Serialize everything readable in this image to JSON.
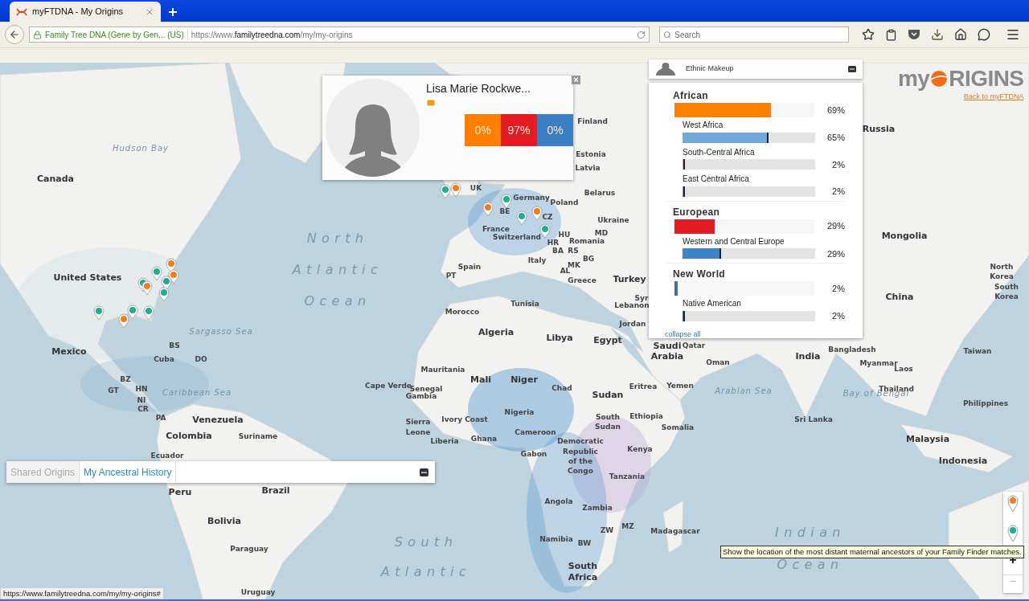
{
  "browser": {
    "tab_title": "myFTDNA - My Origins",
    "site_identity": "Family Tree DNA (Gene by Gen... (US)",
    "url_prefix": "https://www.",
    "url_domain": "familytreedna.com",
    "url_path": "/my/my-origins",
    "search": {
      "placeholder": "Search"
    },
    "status_url": "https://www.familytreedna.com/my/my-origins#"
  },
  "logo": {
    "left": "my",
    "right": "RIGINS",
    "link": "Back to myFTDNA"
  },
  "profile": {
    "name": "Lisa Marie Rockwe...",
    "close": "×",
    "percentages": [
      {
        "value": "0%",
        "color": "#ff8000"
      },
      {
        "value": "97%",
        "color": "#e31b23"
      },
      {
        "value": "0%",
        "color": "#3a7fc1"
      }
    ]
  },
  "ethnic_makeup": {
    "title": "Ethnic Makeup",
    "collapse": "collapse all",
    "groups": [
      {
        "name": "African",
        "percent": "69%",
        "level": 0.69,
        "color": "#ff8000",
        "children": [
          {
            "name": "West Africa",
            "percent": "65%",
            "level": 0.65,
            "color": "#6fa8dc"
          },
          {
            "name": "South-Central Africa",
            "percent": "2%",
            "level": 0.02,
            "color": "#e6a0a8"
          },
          {
            "name": "East Central Africa",
            "percent": "2%",
            "level": 0.02,
            "color": "#8a8ac8"
          }
        ]
      },
      {
        "name": "European",
        "percent": "29%",
        "level": 0.29,
        "color": "#e31b23",
        "children": [
          {
            "name": "Western and Central Europe",
            "percent": "29%",
            "level": 0.29,
            "color": "#3d85c6"
          }
        ]
      },
      {
        "name": "New World",
        "percent": "2%",
        "level": 0.02,
        "color": "#3d6fa8",
        "children": [
          {
            "name": "Native American",
            "percent": "2%",
            "level": 0.02,
            "color": "#3d6fa8"
          }
        ]
      }
    ]
  },
  "tabs": [
    {
      "label": "Shared Origins",
      "selected": false
    },
    {
      "label": "My Ancestral History",
      "selected": true
    }
  ],
  "map_controls": {
    "zoom_in": "+",
    "zoom_out": "−",
    "tooltip": "Show the location of the most distant maternal ancestors of your Family Finder matches."
  },
  "markers": [
    {
      "color": "#f07e1e"
    },
    {
      "color": "#1fae8f"
    },
    {
      "color": "#f07e1e"
    },
    {
      "color": "#1fae8f"
    },
    {
      "color": "#1fae8f"
    },
    {
      "color": "#f07e1e"
    },
    {
      "color": "#1fae8f"
    },
    {
      "color": "#1fae8f"
    },
    {
      "color": "#1fae8f"
    },
    {
      "color": "#1fae8f"
    },
    {
      "color": "#f07e1e"
    },
    {
      "color": "#f07e1e"
    },
    {
      "color": "#1fae8f"
    },
    {
      "color": "#f07e1e"
    },
    {
      "color": "#1fae8f"
    },
    {
      "color": "#f07e1e"
    },
    {
      "color": "#1fae8f"
    },
    {
      "color": "#1fae8f"
    }
  ],
  "map_labels": [
    {
      "text": "Hudson Bay",
      "kind": "sea"
    },
    {
      "text": "Sargasso Sea",
      "kind": "sea"
    },
    {
      "text": "Caribbean Sea",
      "kind": "sea"
    },
    {
      "text": "Arabian Sea",
      "kind": "sea"
    },
    {
      "text": "Bay of Bengal",
      "kind": "sea"
    },
    {
      "text": "North",
      "kind": "ocean"
    },
    {
      "text": "Atlantic",
      "kind": "ocean"
    },
    {
      "text": "Ocean",
      "kind": "ocean"
    },
    {
      "text": "South",
      "kind": "ocean"
    },
    {
      "text": "Atlantic",
      "kind": "ocean"
    },
    {
      "text": "Indian",
      "kind": "ocean"
    },
    {
      "text": "Ocean",
      "kind": "ocean"
    },
    {
      "text": "Canada",
      "kind": "country"
    },
    {
      "text": "United States",
      "kind": "country"
    },
    {
      "text": "Mexico",
      "kind": "country"
    },
    {
      "text": "Cuba",
      "kind": "small"
    },
    {
      "text": "BS",
      "kind": "small"
    },
    {
      "text": "DO",
      "kind": "small"
    },
    {
      "text": "BZ",
      "kind": "small"
    },
    {
      "text": "GT",
      "kind": "small"
    },
    {
      "text": "HN",
      "kind": "small"
    },
    {
      "text": "NI",
      "kind": "small"
    },
    {
      "text": "CR",
      "kind": "small"
    },
    {
      "text": "PA",
      "kind": "small"
    },
    {
      "text": "Venezuela",
      "kind": "country"
    },
    {
      "text": "Colombia",
      "kind": "country"
    },
    {
      "text": "Suriname",
      "kind": "small"
    },
    {
      "text": "Ecuador",
      "kind": "small"
    },
    {
      "text": "Peru",
      "kind": "country"
    },
    {
      "text": "Brazil",
      "kind": "country"
    },
    {
      "text": "Bolivia",
      "kind": "country"
    },
    {
      "text": "Paraguay",
      "kind": "small"
    },
    {
      "text": "Uruguay",
      "kind": "small"
    },
    {
      "text": "Finland",
      "kind": "small"
    },
    {
      "text": "Estonia",
      "kind": "small"
    },
    {
      "text": "Latvia",
      "kind": "small"
    },
    {
      "text": "Belarus",
      "kind": "small"
    },
    {
      "text": "UK",
      "kind": "small"
    },
    {
      "text": "Poland",
      "kind": "small"
    },
    {
      "text": "Germany",
      "kind": "small"
    },
    {
      "text": "BE",
      "kind": "small"
    },
    {
      "text": "CZ",
      "kind": "small"
    },
    {
      "text": "Ukraine",
      "kind": "small"
    },
    {
      "text": "France",
      "kind": "small"
    },
    {
      "text": "Switzerland",
      "kind": "small"
    },
    {
      "text": "HU",
      "kind": "small"
    },
    {
      "text": "MD",
      "kind": "small"
    },
    {
      "text": "HR",
      "kind": "small"
    },
    {
      "text": "Romania",
      "kind": "small"
    },
    {
      "text": "BA",
      "kind": "small"
    },
    {
      "text": "RS",
      "kind": "small"
    },
    {
      "text": "BG",
      "kind": "small"
    },
    {
      "text": "Italy",
      "kind": "small"
    },
    {
      "text": "Spain",
      "kind": "small"
    },
    {
      "text": "MK",
      "kind": "small"
    },
    {
      "text": "PT",
      "kind": "small"
    },
    {
      "text": "AL",
      "kind": "small"
    },
    {
      "text": "Greece",
      "kind": "small"
    },
    {
      "text": "Turkey",
      "kind": "country"
    },
    {
      "text": "Russia",
      "kind": "country"
    },
    {
      "text": "Mongolia",
      "kind": "country"
    },
    {
      "text": "China",
      "kind": "country"
    },
    {
      "text": "North",
      "kind": "small"
    },
    {
      "text": "Korea",
      "kind": "small"
    },
    {
      "text": "South",
      "kind": "small"
    },
    {
      "text": "Korea",
      "kind": "small"
    },
    {
      "text": "Morocco",
      "kind": "small"
    },
    {
      "text": "Tunisia",
      "kind": "small"
    },
    {
      "text": "Algeria",
      "kind": "country"
    },
    {
      "text": "Libya",
      "kind": "country"
    },
    {
      "text": "Egypt",
      "kind": "country"
    },
    {
      "text": "Syr",
      "kind": "small"
    },
    {
      "text": "Lebanon",
      "kind": "small"
    },
    {
      "text": "Jordan",
      "kind": "small"
    },
    {
      "text": "Saudi",
      "kind": "country"
    },
    {
      "text": "Arabia",
      "kind": "country"
    },
    {
      "text": "Qatar",
      "kind": "small"
    },
    {
      "text": "Oman",
      "kind": "small"
    },
    {
      "text": "Yemen",
      "kind": "small"
    },
    {
      "text": "India",
      "kind": "country"
    },
    {
      "text": "Bangladesh",
      "kind": "small"
    },
    {
      "text": "Myanmar",
      "kind": "small"
    },
    {
      "text": "Laos",
      "kind": "small"
    },
    {
      "text": "Taiwan",
      "kind": "small"
    },
    {
      "text": "Thailand",
      "kind": "small"
    },
    {
      "text": "Philippines",
      "kind": "small"
    },
    {
      "text": "Sri Lanka",
      "kind": "small"
    },
    {
      "text": "Malaysia",
      "kind": "country"
    },
    {
      "text": "Indonesia",
      "kind": "country"
    },
    {
      "text": "Mauritania",
      "kind": "small"
    },
    {
      "text": "Mali",
      "kind": "country"
    },
    {
      "text": "Niger",
      "kind": "country"
    },
    {
      "text": "Cape Verde",
      "kind": "small"
    },
    {
      "text": "Senegal",
      "kind": "small"
    },
    {
      "text": "Chad",
      "kind": "small"
    },
    {
      "text": "Eritrea",
      "kind": "small"
    },
    {
      "text": "Gambia",
      "kind": "small"
    },
    {
      "text": "Sudan",
      "kind": "country"
    },
    {
      "text": "Sierra",
      "kind": "small"
    },
    {
      "text": "Ivory Coast",
      "kind": "small"
    },
    {
      "text": "Nigeria",
      "kind": "small"
    },
    {
      "text": "South",
      "kind": "small"
    },
    {
      "text": "Ethiopia",
      "kind": "small"
    },
    {
      "text": "Leone",
      "kind": "small"
    },
    {
      "text": "Cameroon",
      "kind": "small"
    },
    {
      "text": "Sudan",
      "kind": "small"
    },
    {
      "text": "Somalia",
      "kind": "small"
    },
    {
      "text": "Liberia",
      "kind": "small"
    },
    {
      "text": "Ghana",
      "kind": "small"
    },
    {
      "text": "Democratic",
      "kind": "small"
    },
    {
      "text": "Gabon",
      "kind": "small"
    },
    {
      "text": "Republic",
      "kind": "small"
    },
    {
      "text": "Kenya",
      "kind": "small"
    },
    {
      "text": "of the",
      "kind": "small"
    },
    {
      "text": "Congo",
      "kind": "small"
    },
    {
      "text": "Tanzania",
      "kind": "small"
    },
    {
      "text": "Angola",
      "kind": "small"
    },
    {
      "text": "Zambia",
      "kind": "small"
    },
    {
      "text": "ZW",
      "kind": "small"
    },
    {
      "text": "MZ",
      "kind": "small"
    },
    {
      "text": "Madagascar",
      "kind": "small"
    },
    {
      "text": "Namibia",
      "kind": "small"
    },
    {
      "text": "BW",
      "kind": "small"
    },
    {
      "text": "South",
      "kind": "country"
    },
    {
      "text": "Africa",
      "kind": "country"
    }
  ]
}
